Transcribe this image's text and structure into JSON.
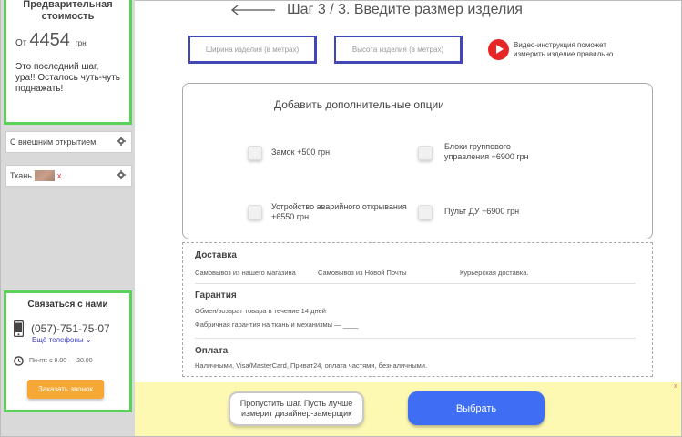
{
  "sidebar": {
    "price": {
      "title": "Предварительная стоимость",
      "from": "От",
      "value": "4454",
      "currency": "грн",
      "note": "Это последний шаг, ура!! Осталось чуть-чуть поднажать!"
    },
    "options": [
      {
        "label": "С внешним открытием",
        "icon": "gear-icon"
      },
      {
        "label": "Ткань",
        "extra": "x",
        "icon": "gear-icon"
      }
    ],
    "contact": {
      "title": "Связаться с нами",
      "phone": "(057)-751-75-07",
      "more_phones": "Ещё телефоны",
      "hours": "Пн-пт: с 9.00 — 20.00",
      "call_button": "Заказать звонок"
    }
  },
  "header": {
    "step_title": "Шаг 3 / 3. Введите размер изделия"
  },
  "size": {
    "width_placeholder": "Ширина изделия (в метрах)",
    "height_placeholder": "Высота изделия (в метрах)",
    "video_text": "Видео-инструкция поможет измерить изделие правильно"
  },
  "options": {
    "title": "Добавить дополнительные опции",
    "items": [
      {
        "label": "Замок  +500 грн"
      },
      {
        "label": "Блоки группового управления +6900 грн"
      },
      {
        "label": "Устройство аварийного открывания +6550 грн"
      },
      {
        "label": "Пульт ДУ  +6900 грн"
      }
    ]
  },
  "info": {
    "delivery_title": "Доставка",
    "delivery_items": [
      "Самовывоз из нашего магазина",
      "Самовывоз из Новой Почты",
      "Курьерская доставка."
    ],
    "warranty_title": "Гарантия",
    "warranty_line1": "Обмен/возврат товара в течение 14 дней",
    "warranty_line2": "Фабричная гарантия на ткань и механизмы — ____",
    "payment_title": "Оплата",
    "payment_text": "Наличными, Visa/MasterCard, Приват24, оплата частями, безналичными."
  },
  "footer": {
    "skip_button": "Пропустить шаг. Пусть лучше измерит дизайнер-замерщик",
    "choose_button": "Выбрать",
    "close": "x"
  },
  "colors": {
    "accent_green": "#5ad25a",
    "input_border": "#4546b6",
    "primary_button": "#3f6ef5",
    "call_button": "#f6a835",
    "video_red": "#e62625",
    "bottom_bar": "#fdf8b2"
  }
}
